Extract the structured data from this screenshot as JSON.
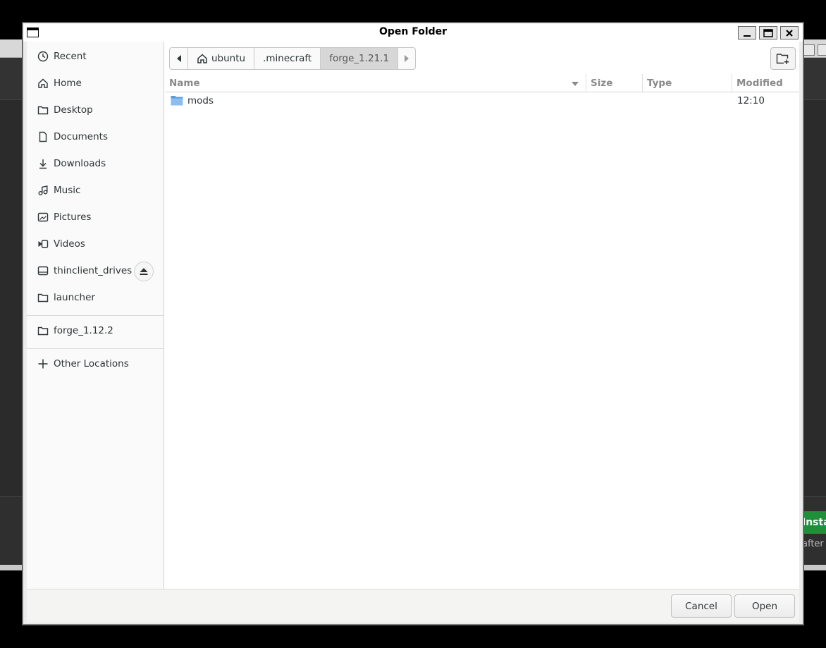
{
  "dialog": {
    "title": "Open Folder"
  },
  "sidebar": {
    "items": [
      {
        "label": "Recent",
        "icon": "clock-icon"
      },
      {
        "label": "Home",
        "icon": "home-icon"
      },
      {
        "label": "Desktop",
        "icon": "folder-icon"
      },
      {
        "label": "Documents",
        "icon": "document-icon"
      },
      {
        "label": "Downloads",
        "icon": "download-icon"
      },
      {
        "label": "Music",
        "icon": "music-icon"
      },
      {
        "label": "Pictures",
        "icon": "picture-icon"
      },
      {
        "label": "Videos",
        "icon": "video-icon"
      },
      {
        "label": "thinclient_drives",
        "icon": "drive-icon"
      },
      {
        "label": "launcher",
        "icon": "folder-icon"
      }
    ],
    "bookmarks": [
      {
        "label": "forge_1.12.2",
        "icon": "folder-icon"
      }
    ],
    "other_locations": {
      "label": "Other Locations",
      "icon": "plus-icon"
    }
  },
  "pathbar": {
    "segments": [
      "ubuntu",
      ".minecraft",
      "forge_1.21.1"
    ],
    "active": "forge_1.21.1"
  },
  "filelist": {
    "columns": {
      "name": "Name",
      "size": "Size",
      "type": "Type",
      "modified": "Modified"
    },
    "rows": [
      {
        "name": "mods",
        "size": "",
        "type": "",
        "modified": "12:10",
        "icon": "folder-icon"
      }
    ]
  },
  "footer": {
    "cancel_label": "Cancel",
    "open_label": "Open"
  },
  "background": {
    "install_label": "Insta",
    "after_label": "after In"
  },
  "colors": {
    "folder": "#5b9bd5",
    "install": "#1f8f3a"
  }
}
